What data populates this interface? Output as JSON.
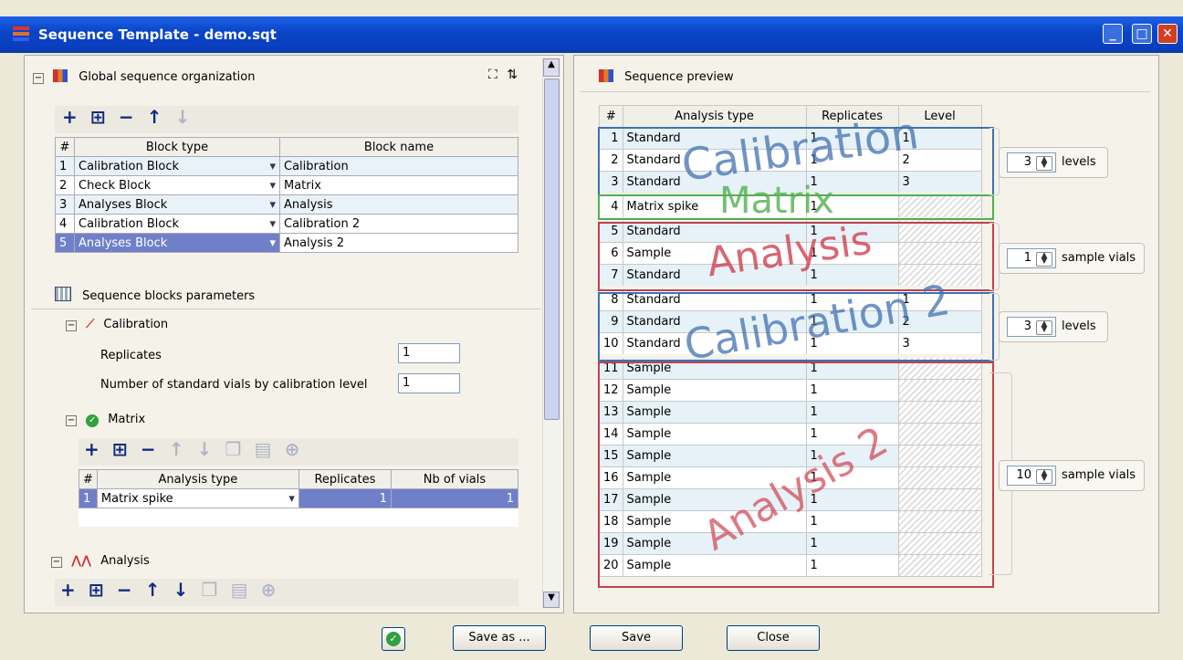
{
  "window": {
    "title": "Sequence Template - demo.sqt"
  },
  "left": {
    "section_title": "Global sequence organization",
    "block_columns": [
      "#",
      "Block type",
      "Block name"
    ],
    "blocks": [
      {
        "n": "1",
        "type": "Calibration Block",
        "name": "Calibration"
      },
      {
        "n": "2",
        "type": "Check Block",
        "name": "Matrix"
      },
      {
        "n": "3",
        "type": "Analyses Block",
        "name": "Analysis"
      },
      {
        "n": "4",
        "type": "Calibration Block",
        "name": "Calibration 2"
      },
      {
        "n": "5",
        "type": "Analyses Block",
        "name": "Analysis 2"
      }
    ],
    "params_title": "Sequence blocks parameters",
    "calibration": {
      "title": "Calibration",
      "replicates_label": "Replicates",
      "replicates_value": "1",
      "vials_label": "Number of standard vials by calibration level",
      "vials_value": "1"
    },
    "matrix": {
      "title": "Matrix",
      "columns": [
        "#",
        "Analysis type",
        "Replicates",
        "Nb of vials"
      ],
      "rows": [
        {
          "n": "1",
          "type": "Matrix spike",
          "rep": "1",
          "vials": "1"
        }
      ]
    },
    "analysis": {
      "title": "Analysis"
    }
  },
  "right": {
    "title": "Sequence preview",
    "columns": [
      "#",
      "Analysis type",
      "Replicates",
      "Level"
    ],
    "rows": [
      {
        "n": "1",
        "type": "Standard",
        "rep": "1",
        "level": "1"
      },
      {
        "n": "2",
        "type": "Standard",
        "rep": "1",
        "level": "2"
      },
      {
        "n": "3",
        "type": "Standard",
        "rep": "1",
        "level": "3"
      },
      {
        "n": "4",
        "type": "Matrix spike",
        "rep": "1",
        "level": ""
      },
      {
        "n": "5",
        "type": "Standard",
        "rep": "1",
        "level": ""
      },
      {
        "n": "6",
        "type": "Sample",
        "rep": "1",
        "level": ""
      },
      {
        "n": "7",
        "type": "Standard",
        "rep": "1",
        "level": ""
      },
      {
        "n": "8",
        "type": "Standard",
        "rep": "1",
        "level": "1"
      },
      {
        "n": "9",
        "type": "Standard",
        "rep": "1",
        "level": "2"
      },
      {
        "n": "10",
        "type": "Standard",
        "rep": "1",
        "level": "3"
      },
      {
        "n": "11",
        "type": "Sample",
        "rep": "1",
        "level": ""
      },
      {
        "n": "12",
        "type": "Sample",
        "rep": "1",
        "level": ""
      },
      {
        "n": "13",
        "type": "Sample",
        "rep": "1",
        "level": ""
      },
      {
        "n": "14",
        "type": "Sample",
        "rep": "1",
        "level": ""
      },
      {
        "n": "15",
        "type": "Sample",
        "rep": "1",
        "level": ""
      },
      {
        "n": "16",
        "type": "Sample",
        "rep": "1",
        "level": ""
      },
      {
        "n": "17",
        "type": "Sample",
        "rep": "1",
        "level": ""
      },
      {
        "n": "18",
        "type": "Sample",
        "rep": "1",
        "level": ""
      },
      {
        "n": "19",
        "type": "Sample",
        "rep": "1",
        "level": ""
      },
      {
        "n": "20",
        "type": "Sample",
        "rep": "1",
        "level": ""
      }
    ],
    "overlays": [
      "Calibration",
      "Matrix",
      "Analysis",
      "Calibration 2",
      "Analysis 2"
    ],
    "spinners": [
      {
        "value": "3",
        "label": "levels"
      },
      {
        "value": "1",
        "label": "sample vials"
      },
      {
        "value": "3",
        "label": "levels"
      },
      {
        "value": "10",
        "label": "sample vials"
      }
    ]
  },
  "buttons": {
    "save_as": "Save as ...",
    "save": "Save",
    "close": "Close"
  },
  "colors": {
    "calibration": "#4070b0",
    "matrix": "#50b050",
    "analysis": "#d04050",
    "titlebar": "#0a46c8"
  }
}
